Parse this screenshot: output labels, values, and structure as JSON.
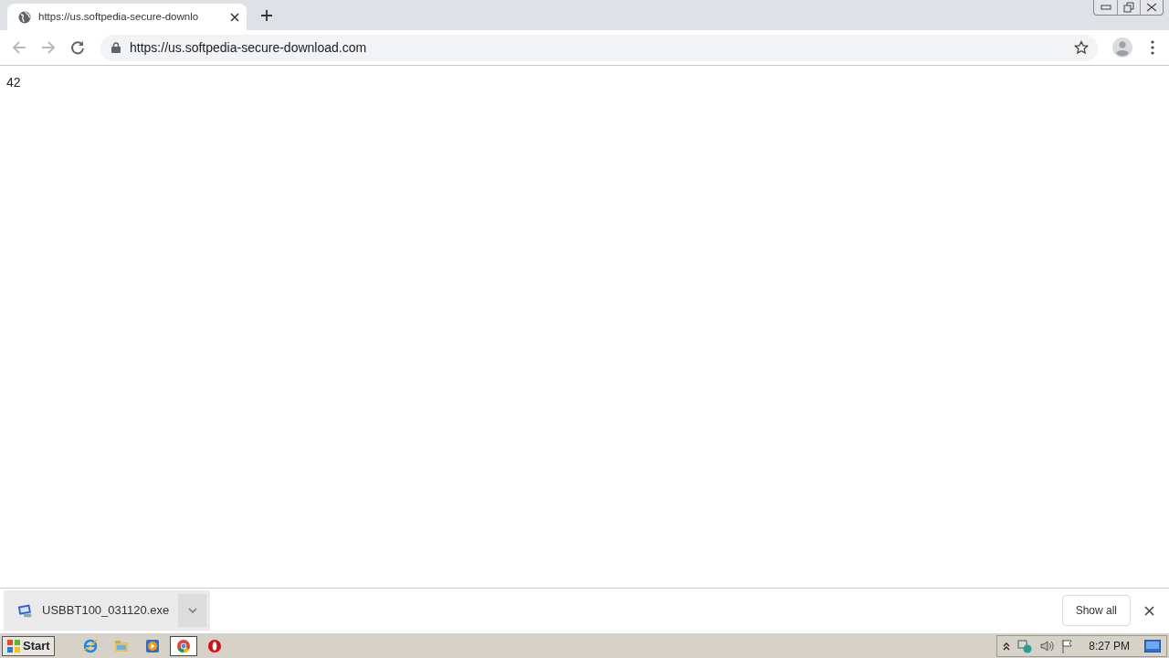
{
  "tab": {
    "title": "https://us.softpedia-secure-downlo"
  },
  "address_bar": {
    "url": "https://us.softpedia-secure-download.com"
  },
  "page": {
    "text": "42"
  },
  "download_bar": {
    "file": "USBBT100_031120.exe",
    "show_all": "Show all"
  },
  "taskbar": {
    "start": "Start",
    "apps": [
      {
        "kind": "ie",
        "selected": false
      },
      {
        "kind": "folder",
        "selected": false
      },
      {
        "kind": "media",
        "selected": false
      },
      {
        "kind": "chrome",
        "selected": true
      },
      {
        "kind": "opera",
        "selected": false
      }
    ],
    "clock": "8:27 PM"
  }
}
